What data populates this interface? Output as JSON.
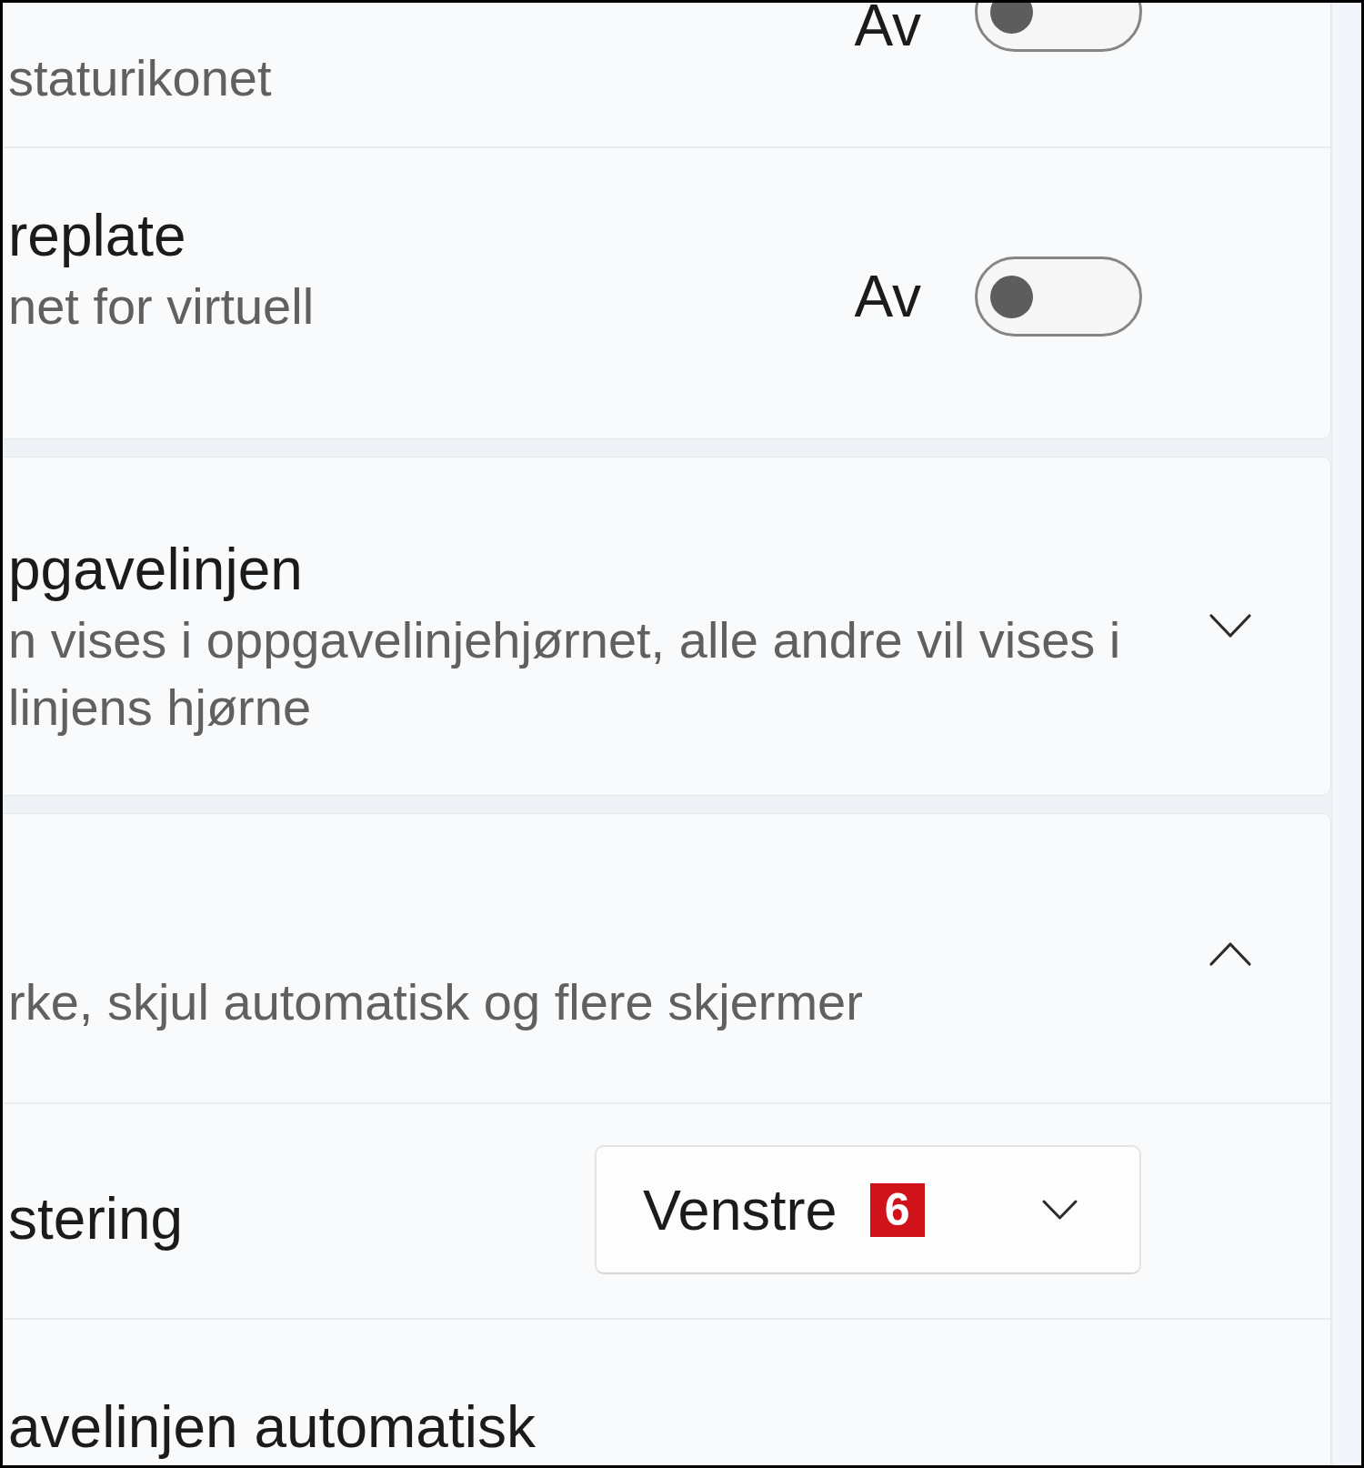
{
  "cards": [
    {
      "rows": [
        {
          "kind": "toggle",
          "description_lines": [
            "staturikonet"
          ],
          "state_label": "Av",
          "on": false
        },
        {
          "kind": "toggle",
          "title": "replate",
          "description_lines": [
            "net for virtuell"
          ],
          "state_label": "Av",
          "on": false
        }
      ]
    },
    {
      "rows": [
        {
          "kind": "expander",
          "title": "pgavelinjen",
          "description_lines": [
            "n vises i oppgavelinjehjørnet, alle andre vil vises i",
            "linjens hjørne"
          ],
          "expanded": false
        }
      ]
    },
    {
      "rows": [
        {
          "kind": "expander",
          "description_lines": [
            "rke, skjul automatisk og flere skjermer"
          ],
          "expanded": true
        },
        {
          "kind": "dropdown",
          "title": "stering",
          "value": "Venstre",
          "badge": "6"
        },
        {
          "kind": "label",
          "title": "avelinjen automatisk"
        }
      ]
    }
  ]
}
